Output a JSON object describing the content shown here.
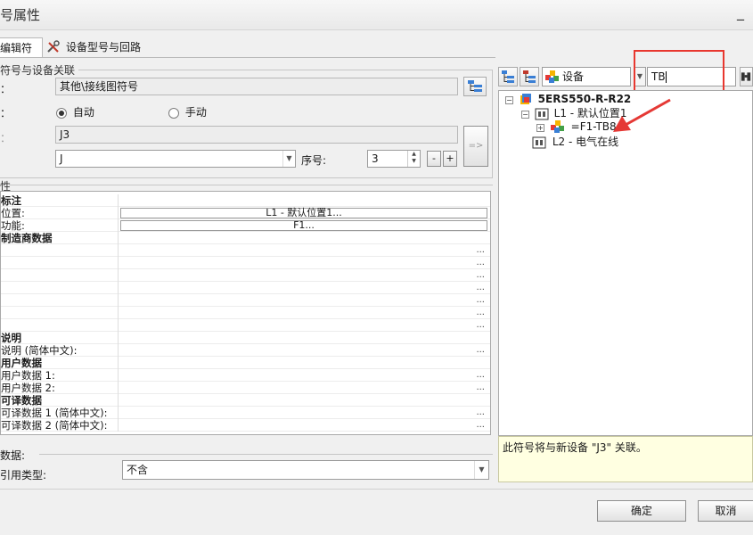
{
  "window": {
    "title": "号属性",
    "minimize_glyph": "_"
  },
  "tabs": [
    {
      "label": "编辑符号"
    },
    {
      "label": "设备型号与回路"
    }
  ],
  "symbol_section": {
    "header": "符号与设备关联",
    "row1_label": "：",
    "symbol_library_value": "其他\\接线图符号",
    "row2_label": "：",
    "radio_auto": "自动",
    "radio_manual": "手动",
    "row3_label": "：",
    "device_value": "J3",
    "prefix_value": "J",
    "seq_label": "序号:",
    "seq_value": "3",
    "minus": "-",
    "plus": "+",
    "assign_arrow": "=>"
  },
  "props_section": {
    "header": "性"
  },
  "props_rows": [
    {
      "label": "标注",
      "value": "",
      "bold": true,
      "type": "none"
    },
    {
      "label": "位置:",
      "value": "L1 - 默认位置1...",
      "bold": false,
      "type": "box"
    },
    {
      "label": "功能:",
      "value": "F1...",
      "bold": false,
      "type": "box"
    },
    {
      "label": "制造商数据",
      "value": "",
      "bold": true,
      "type": "none"
    },
    {
      "label": "",
      "value": "...",
      "bold": false,
      "type": "dots"
    },
    {
      "label": "",
      "value": "...",
      "bold": false,
      "type": "dots"
    },
    {
      "label": "",
      "value": "...",
      "bold": false,
      "type": "dots"
    },
    {
      "label": "",
      "value": "...",
      "bold": false,
      "type": "dots"
    },
    {
      "label": "",
      "value": "...",
      "bold": false,
      "type": "dots"
    },
    {
      "label": "",
      "value": "...",
      "bold": false,
      "type": "dots"
    },
    {
      "label": "",
      "value": "...",
      "bold": false,
      "type": "dots"
    },
    {
      "label": "说明",
      "value": "",
      "bold": true,
      "type": "none"
    },
    {
      "label": "说明 (简体中文):",
      "value": "...",
      "bold": false,
      "type": "dots"
    },
    {
      "label": "用户数据",
      "value": "",
      "bold": true,
      "type": "none"
    },
    {
      "label": "用户数据 1:",
      "value": "...",
      "bold": false,
      "type": "dots"
    },
    {
      "label": "用户数据 2:",
      "value": "...",
      "bold": false,
      "type": "dots"
    },
    {
      "label": "可译数据",
      "value": "",
      "bold": true,
      "type": "none"
    },
    {
      "label": "可译数据 1 (简体中文):",
      "value": "...",
      "bold": false,
      "type": "dots"
    },
    {
      "label": "可译数据 2 (简体中文):",
      "value": "...",
      "bold": false,
      "type": "dots"
    }
  ],
  "bottom_section": {
    "data_label": "数据:",
    "ref_type_label": "引用类型:",
    "ref_type_value": "不含"
  },
  "right_toolbar": {
    "filter_value": "设备",
    "search_value": "TB"
  },
  "tree": {
    "root": "5ERS550-R-R22",
    "loc1": "L1 - 默认位置1",
    "device": "=F1-TB8",
    "loc2": "L2 - 电气在线"
  },
  "info_note": "此符号将与新设备 \"J3\" 关联。",
  "footer": {
    "ok": "确定",
    "cancel": "取消"
  },
  "colors": {
    "highlight_red": "#e8372f",
    "arrow_red": "#e53935"
  }
}
